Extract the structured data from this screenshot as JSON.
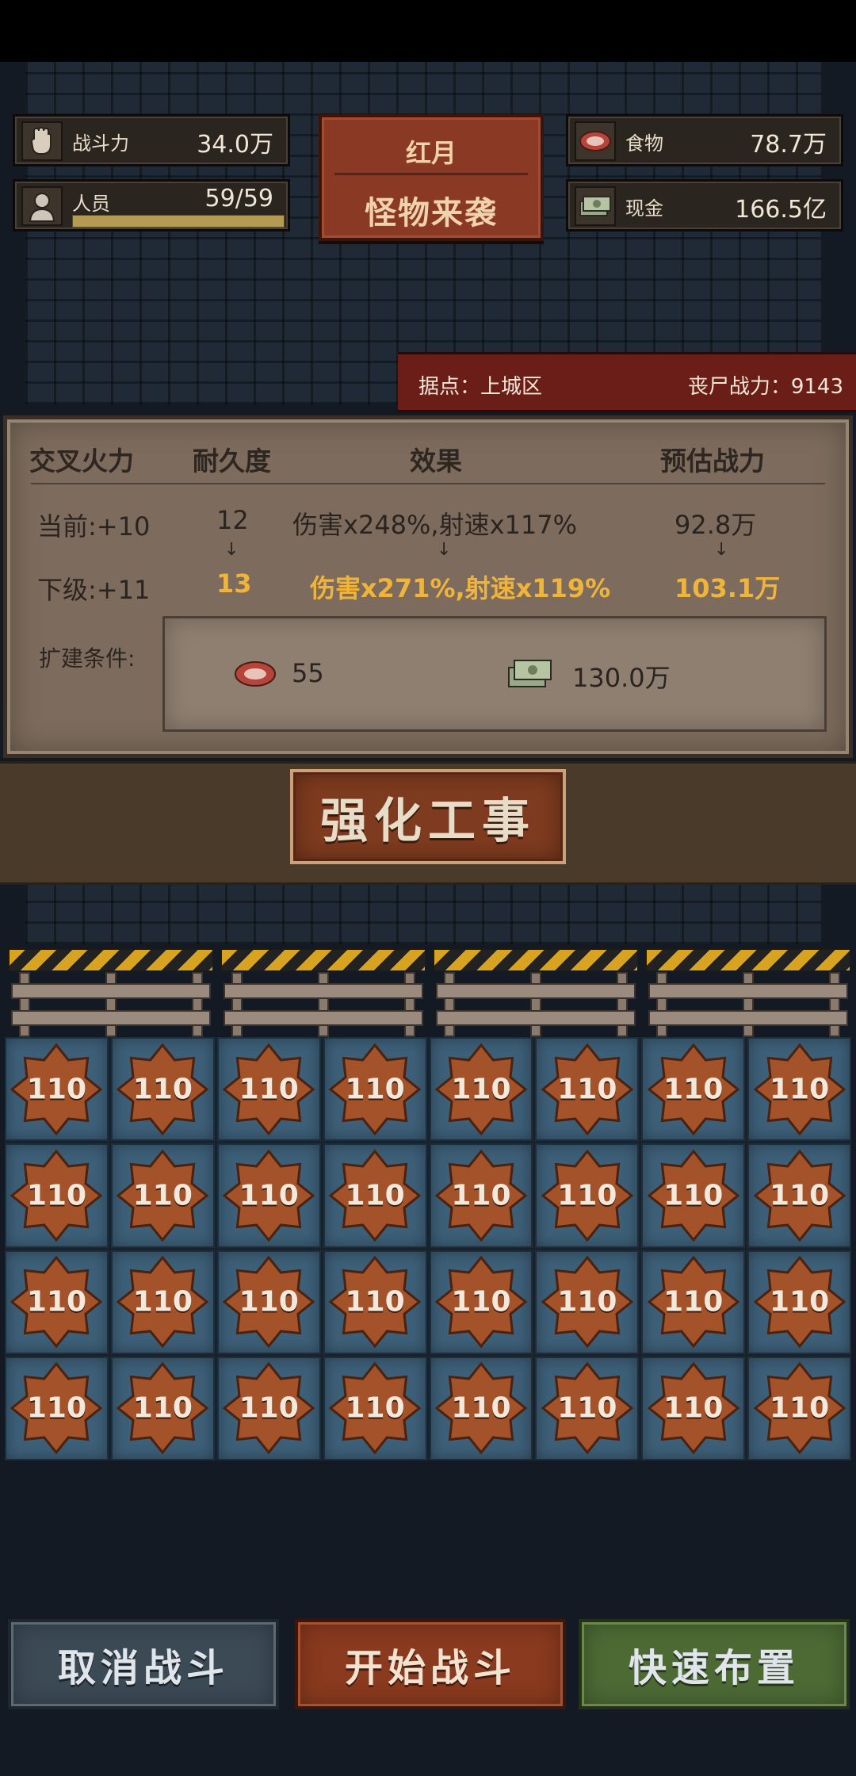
{
  "stats": {
    "combat_power": {
      "label": "战斗力",
      "value": "34.0万"
    },
    "personnel": {
      "label": "人员",
      "value": "59/59",
      "fill_fraction": 1.0
    },
    "food": {
      "label": "食物",
      "value": "78.7万"
    },
    "cash": {
      "label": "现金",
      "value": "166.5亿"
    }
  },
  "event": {
    "title": "红月",
    "subtitle": "怪物来袭"
  },
  "location": {
    "base": "据点：上城区",
    "zombie_power": "丧尸战力：9143"
  },
  "panel": {
    "headers": {
      "name": "交叉火力",
      "durability": "耐久度",
      "effect": "效果",
      "estimate": "预估战力"
    },
    "current": {
      "level": "当前:+10",
      "durability": "12",
      "effect": "伤害x248%,射速x117%",
      "estimate": "92.8万"
    },
    "next": {
      "level": "下级:+11",
      "durability": "13",
      "effect": "伤害x271%,射速x119%",
      "estimate": "103.1万"
    },
    "arrow": "↓",
    "requirement_label": "扩建条件:",
    "requirements": {
      "food": "55",
      "cash": "130.0万"
    }
  },
  "upgrade_button": "强化工事",
  "grid": {
    "rows": 4,
    "cols": 8,
    "cell_value": "110"
  },
  "buttons": {
    "cancel": "取消战斗",
    "start": "开始战斗",
    "quick": "快速布置"
  },
  "colors": {
    "accent_next": "#f0b43a",
    "event_red": "#8a3a24",
    "cell_blue": "#3d5f78"
  },
  "icons": {
    "combat": "fist-icon",
    "personnel": "person-icon",
    "food": "meat-icon",
    "cash": "cash-icon"
  }
}
